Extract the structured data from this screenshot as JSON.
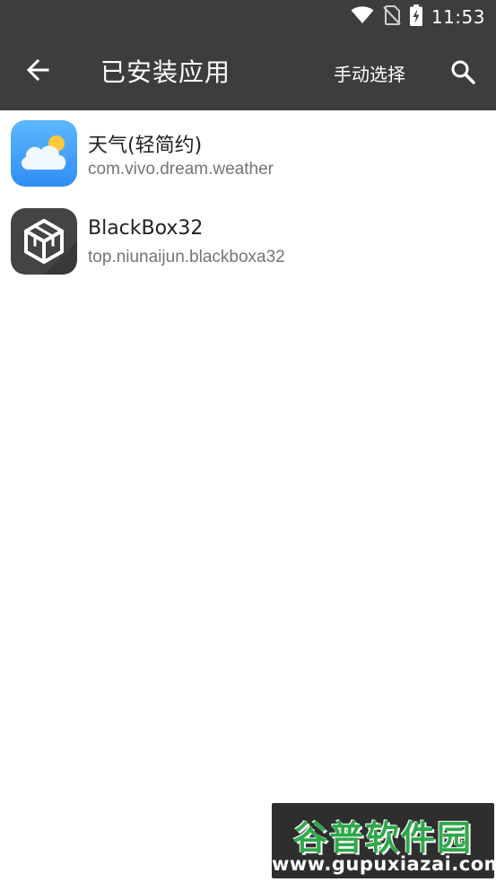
{
  "status_bar": {
    "time": "11:53",
    "icons": [
      "wifi-icon",
      "no-sim-icon",
      "battery-charging-icon"
    ]
  },
  "toolbar": {
    "title": "已安装应用",
    "manual_select_label": "手动选择",
    "back_icon": "arrow-left-icon",
    "search_icon": "search-icon"
  },
  "apps": [
    {
      "name": "天气(轻简约)",
      "package": "com.vivo.dream.weather",
      "icon": "weather-app-icon"
    },
    {
      "name": "BlackBox32",
      "package": "top.niunaijun.blackboxa32",
      "icon": "blackbox-app-icon"
    }
  ],
  "watermark": {
    "logo_text": "谷普软件园",
    "url": "www.gupuxiazai.com"
  },
  "colors": {
    "toolbar_bg": "#3d3d3d",
    "watermark_green": "#2ea84a"
  }
}
